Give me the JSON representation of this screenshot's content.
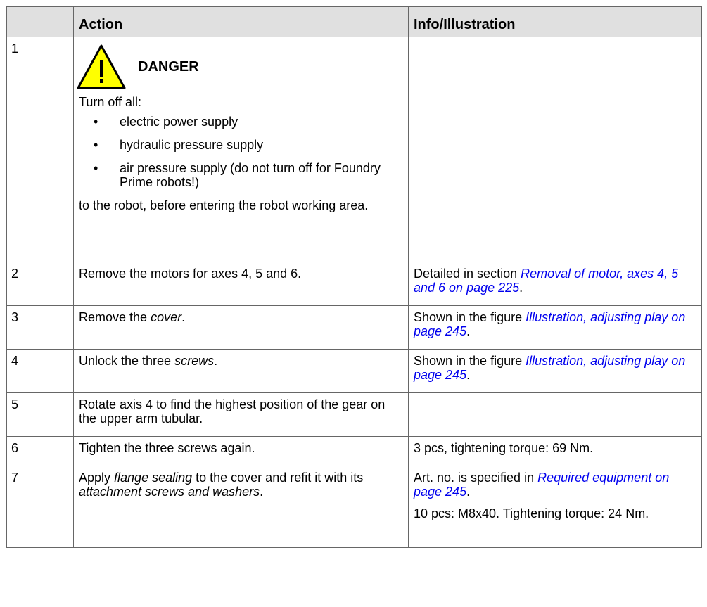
{
  "headers": {
    "col1": "",
    "col2": "Action",
    "col3": "Info/Illustration"
  },
  "rows": {
    "r1": {
      "num": "1",
      "danger_title": "DANGER",
      "intro": "Turn off all:",
      "bullets": [
        "electric power supply",
        "hydraulic pressure supply",
        "air pressure supply (do not turn off for Foundry Prime robots!)"
      ],
      "outro": "to the robot, before entering the robot working area."
    },
    "r2": {
      "num": "2",
      "action": "Remove the motors for axes 4, 5 and 6.",
      "info_pre": "Detailed in section ",
      "info_link": "Removal of motor, axes 4, 5 and 6 on page 225",
      "info_post": "."
    },
    "r3": {
      "num": "3",
      "action_pre": "Remove the ",
      "action_em": "cover",
      "action_post": ".",
      "info_pre": "Shown in the figure ",
      "info_link": "Illustration, adjusting play on page 245",
      "info_post": "."
    },
    "r4": {
      "num": "4",
      "action_pre": "Unlock the three ",
      "action_em": "screws",
      "action_post": ".",
      "info_pre": "Shown in the figure ",
      "info_link": "Illustration, adjusting play on page 245",
      "info_post": "."
    },
    "r5": {
      "num": "5",
      "action": "Rotate axis 4 to find the highest position of the gear on the upper arm tubular."
    },
    "r6": {
      "num": "6",
      "action": "Tighten the three screws again.",
      "info": "3 pcs, tightening torque: 69 Nm."
    },
    "r7": {
      "num": "7",
      "action_pre": "Apply ",
      "action_em1": "flange sealing",
      "action_mid": " to the cover and refit it with its ",
      "action_em2": "attachment screws and washers",
      "action_post": ".",
      "info1_pre": "Art. no. is specified in ",
      "info1_link": "Required equipment on page 245",
      "info1_post": ".",
      "info2": "10 pcs: M8x40. Tightening torque: 24 Nm."
    }
  },
  "colors": {
    "header_bg": "#e0e0e0",
    "link": "#0000ee",
    "warning_yellow": "#ffff00"
  }
}
